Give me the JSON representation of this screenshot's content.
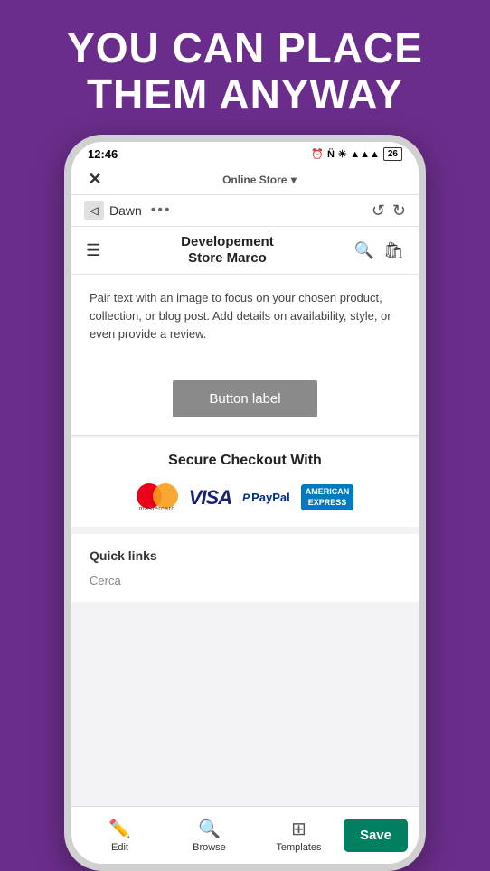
{
  "hero": {
    "line1": "You can place",
    "line2": "them anyway"
  },
  "status_bar": {
    "time": "12:46",
    "alarm_icon": "⏰",
    "n_icon": "Ⓝ",
    "bluetooth": "⬡",
    "signal": "▲▲▲",
    "battery": "26+"
  },
  "nav": {
    "close_icon": "✕",
    "title": "Online Store",
    "dropdown_icon": "▾"
  },
  "dawn_bar": {
    "back_icon": "◁",
    "label": "Dawn",
    "dots": "•••",
    "undo_icon": "↺",
    "redo_icon": "↻"
  },
  "store_header": {
    "menu_icon": "☰",
    "store_name_line1": "Developement",
    "store_name_line2": "Store Marco",
    "search_icon": "🔍",
    "bag_icon": "🛍"
  },
  "content": {
    "pair_text": "Pair text with an image to focus on your chosen product, collection, or blog post. Add details on availability, style, or even provide a review."
  },
  "button": {
    "label": "Button label"
  },
  "checkout": {
    "title": "Secure Checkout With",
    "mastercard_label": "mastercard",
    "visa_label": "VISA",
    "paypal_prefix": "P",
    "paypal_label": "PayPal",
    "amex_line1": "AMERICAN",
    "amex_line2": "EXPRESS"
  },
  "quick_links": {
    "title": "Quick links",
    "cerca_placeholder": "Cerca"
  },
  "toolbar": {
    "edit_label": "Edit",
    "browse_label": "Browse",
    "templates_label": "Templates",
    "save_label": "Save",
    "edit_icon": "✏",
    "browse_icon": "🔍",
    "templates_icon": "⊞"
  }
}
